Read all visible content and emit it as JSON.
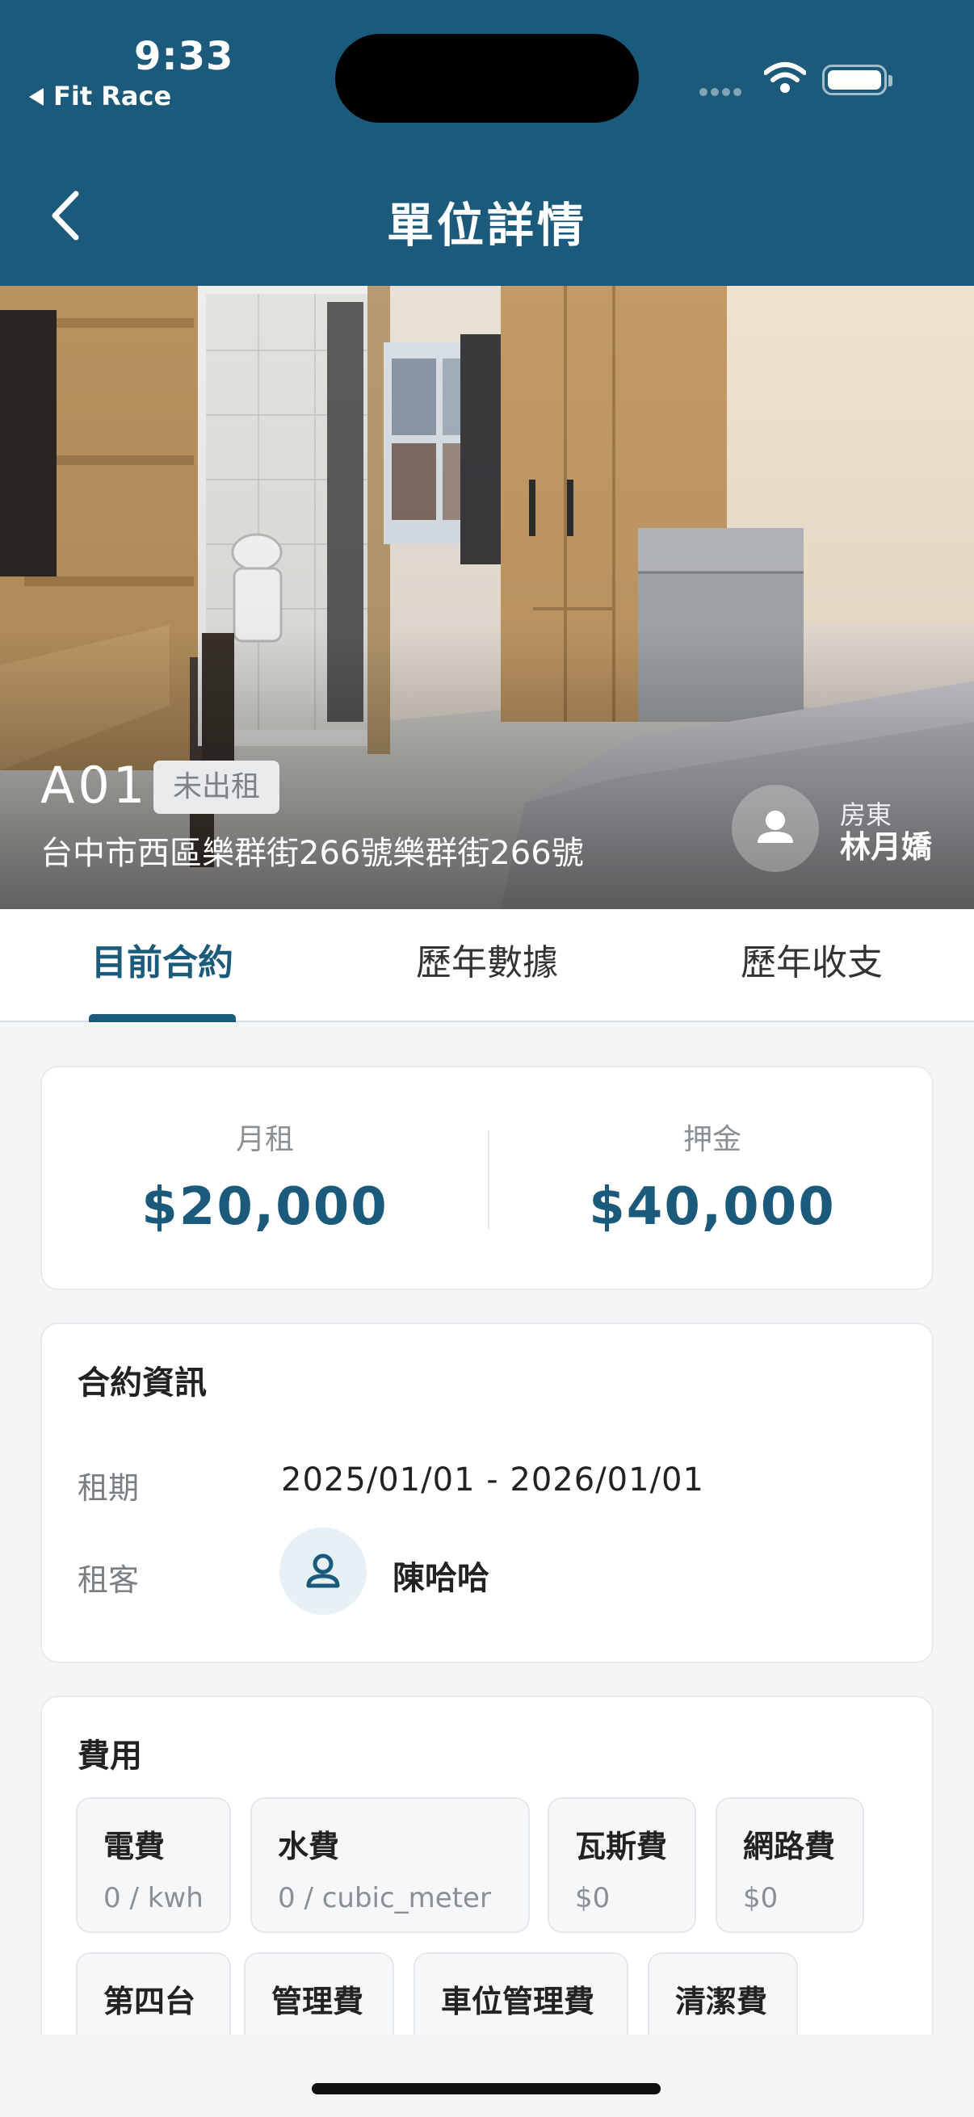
{
  "status_bar": {
    "time": "9:33",
    "back_app": "Fit Race"
  },
  "nav": {
    "title": "單位詳情"
  },
  "unit": {
    "code": "A01",
    "status": "未出租",
    "address": "台中市西區樂群街266號樂群街266號",
    "landlord_role": "房東",
    "landlord_name": "林月嬌"
  },
  "tabs": [
    {
      "label": "目前合約",
      "active": true
    },
    {
      "label": "歷年數據",
      "active": false
    },
    {
      "label": "歷年收支",
      "active": false
    }
  ],
  "rent": {
    "monthly_label": "月租",
    "monthly_value": "$20,000",
    "deposit_label": "押金",
    "deposit_value": "$40,000"
  },
  "contract": {
    "title": "合約資訊",
    "period_label": "租期",
    "period_value": "2025/01/01 - 2026/01/01",
    "tenant_label": "租客",
    "tenant_name": "陳哈哈"
  },
  "fees": {
    "title": "費用",
    "items": [
      {
        "name": "電費",
        "value": "0 / kwh"
      },
      {
        "name": "水費",
        "value": "0 / cubic_meter"
      },
      {
        "name": "瓦斯費",
        "value": "$0"
      },
      {
        "name": "網路費",
        "value": "$0"
      },
      {
        "name": "第四台",
        "value": ""
      },
      {
        "name": "管理費",
        "value": ""
      },
      {
        "name": "車位管理費",
        "value": ""
      },
      {
        "name": "清潔費",
        "value": ""
      }
    ]
  },
  "colors": {
    "primary": "#1c5a7b",
    "background": "#f4f5f6"
  }
}
